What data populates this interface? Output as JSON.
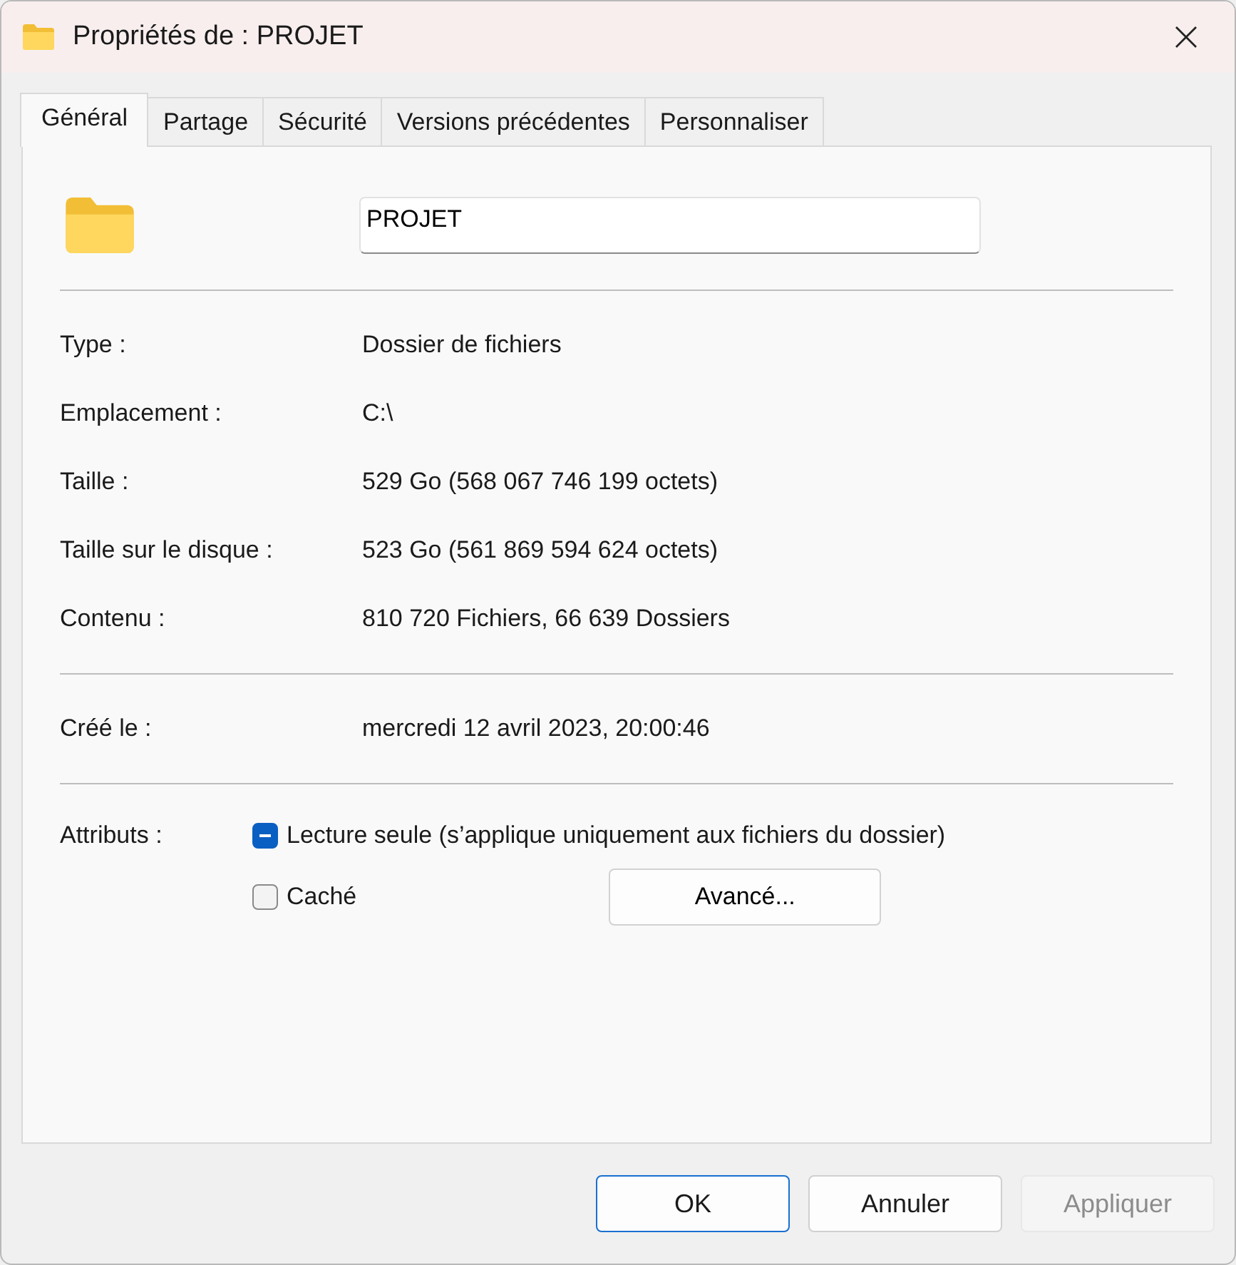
{
  "window": {
    "title": "Propriétés de : PROJET"
  },
  "tabs": [
    {
      "label": "Général",
      "selected": true
    },
    {
      "label": "Partage",
      "selected": false
    },
    {
      "label": "Sécurité",
      "selected": false
    },
    {
      "label": "Versions précédentes",
      "selected": false
    },
    {
      "label": "Personnaliser",
      "selected": false
    }
  ],
  "name_field": {
    "value": "PROJET"
  },
  "sections": [
    [
      {
        "label": "Type :",
        "value": "Dossier de fichiers"
      },
      {
        "label": "Emplacement :",
        "value": "C:\\"
      },
      {
        "label": "Taille :",
        "value": "529 Go (568 067 746 199 octets)"
      },
      {
        "label": "Taille sur le disque :",
        "value": "523 Go (561 869 594 624 octets)"
      },
      {
        "label": "Contenu :",
        "value": "810 720 Fichiers, 66 639 Dossiers"
      }
    ],
    [
      {
        "label": "Créé le :",
        "value": "mercredi 12 avril 2023, 20:00:46"
      }
    ]
  ],
  "attributes": {
    "label": "Attributs :",
    "options": [
      {
        "label": "Lecture seule (s’applique uniquement aux fichiers du dossier)",
        "checked": true,
        "indeterminate": true
      },
      {
        "label": "Caché",
        "checked": false,
        "indeterminate": false
      }
    ],
    "advanced_button": "Avancé..."
  },
  "buttons": [
    {
      "label": "OK",
      "default": true,
      "disabled": false
    },
    {
      "label": "Annuler",
      "default": false,
      "disabled": false
    },
    {
      "label": "Appliquer",
      "default": false,
      "disabled": true
    }
  ]
}
